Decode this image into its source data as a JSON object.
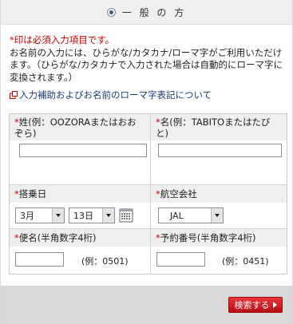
{
  "section": {
    "title": "一 般 の 方"
  },
  "notes": {
    "required": "*印は必須入力項目です。",
    "intro": "お名前の入力には、ひらがな/カタカナ/ローマ字がご利用いただけます。（ひらがな/カタカナで入力された場合は自動的にローマ字に変換されます。）"
  },
  "link": {
    "label": "入力補助およびお名前のローマ字表記について"
  },
  "form": {
    "surname": {
      "asterisk": "*",
      "label": "姓(例：OOZORAまたはおおぞら)",
      "value": ""
    },
    "given_name": {
      "asterisk": "*",
      "label": "名(例：TABITOまたはたびと)",
      "value": ""
    },
    "boarding_date": {
      "asterisk": "*",
      "label": "搭乗日",
      "month": "3月",
      "day": "13日"
    },
    "airline": {
      "asterisk": "*",
      "label": "航空会社",
      "value": "JAL"
    },
    "flight_number": {
      "asterisk": "*",
      "label": "便名(半角数字4桁)",
      "value": "",
      "example": "(例：0501)"
    },
    "booking_number": {
      "asterisk": "*",
      "label": "予約番号(半角数字4桁)",
      "value": "",
      "example": "(例：0451)"
    }
  },
  "footer": {
    "search_label": "検索する"
  },
  "colors": {
    "accent": "#cc0000",
    "button": "#d0161c",
    "link": "#1c3a7a"
  },
  "icons": {
    "radio": "radio-selected-icon",
    "link": "external-link-icon",
    "calendar": "calendar-icon",
    "button": "arrow-right-icon"
  }
}
